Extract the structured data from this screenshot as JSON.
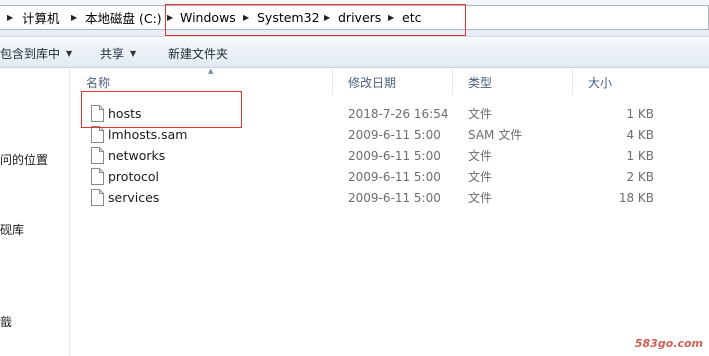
{
  "breadcrumb": {
    "items": [
      "计算机",
      "本地磁盘 (C:)",
      "Windows",
      "System32",
      "drivers",
      "etc"
    ]
  },
  "toolbar": {
    "include_library_label": "包含到库中",
    "share_label": "共享",
    "new_folder_label": "新建文件夹"
  },
  "nav": {
    "items": [
      "问的位置",
      "砚库",
      "戠"
    ]
  },
  "columns": {
    "name": "名称",
    "date": "修改日期",
    "type": "类型",
    "size": "大小"
  },
  "files": [
    {
      "name": "hosts",
      "date": "2018-7-26 16:54",
      "type": "文件",
      "size": "1 KB"
    },
    {
      "name": "lmhosts.sam",
      "date": "2009-6-11 5:00",
      "type": "SAM 文件",
      "size": "4 KB"
    },
    {
      "name": "networks",
      "date": "2009-6-11 5:00",
      "type": "文件",
      "size": "1 KB"
    },
    {
      "name": "protocol",
      "date": "2009-6-11 5:00",
      "type": "文件",
      "size": "2 KB"
    },
    {
      "name": "services",
      "date": "2009-6-11 5:00",
      "type": "文件",
      "size": "18 KB"
    }
  ],
  "watermark": "583go.com",
  "colors": {
    "highlight": "#e0362c",
    "header_text": "#4c607a"
  }
}
